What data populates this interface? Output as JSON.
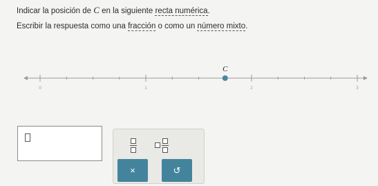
{
  "instructions": {
    "line1_part1": "Indicar la posición de ",
    "line1_var": "C",
    "line1_part2": " en la siguiente ",
    "line1_link": "recta numérica",
    "line1_end": ".",
    "line2_part1": "Escribir la respuesta como una ",
    "line2_link1": "fracción",
    "line2_mid": " o como un ",
    "line2_link2": "número mixto",
    "line2_end": "."
  },
  "number_line": {
    "point_label": "C",
    "point_value": 1.75,
    "min": 0,
    "max": 3,
    "tick_labels": [
      "0",
      "1",
      "2",
      "3"
    ],
    "point_color": "#4a86a0"
  },
  "answer": {
    "value": ""
  },
  "keypad": {
    "fraction_button": "fraction",
    "mixed_button": "mixed-number",
    "clear_symbol": "×",
    "undo_symbol": "↺",
    "button_color": "#43849c"
  }
}
